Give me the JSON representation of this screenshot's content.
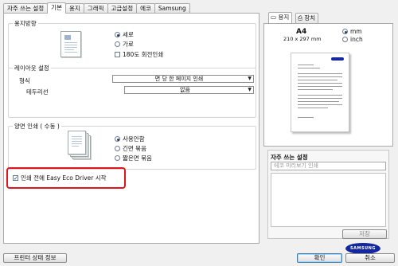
{
  "tabs": [
    "자주 쓰는 설정",
    "기본",
    "용지",
    "그래픽",
    "고급설정",
    "에코",
    "Samsung"
  ],
  "active_tab_index": 1,
  "orientation": {
    "title": "용지방향",
    "portrait": "세로",
    "landscape": "가로",
    "rotate_180": "180도 회전인쇄"
  },
  "layout": {
    "title": "레이아웃 설정",
    "type_label": "형식",
    "type_value": "면 당 한 페이지 인쇄",
    "border_label": "테두리선",
    "border_value": "없음"
  },
  "duplex": {
    "title": "양면 인쇄 ( 수동 )",
    "none": "사용안함",
    "long_edge": "긴면 묶음",
    "short_edge": "짧은면 묶음"
  },
  "eco": {
    "label": "인쇄 전에 Easy Eco Driver 시작",
    "checked": true
  },
  "right_panel": {
    "tab_paper": "용지",
    "tab_device": "장치",
    "paper_size": "A4",
    "paper_dims": "210 x 297 mm",
    "unit_mm": "mm",
    "unit_inch": "inch",
    "favorites_title": "자주 쓰는 설정",
    "favorites_placeholder": "에코 미리보기 인쇄",
    "save_button": "저장"
  },
  "bottom": {
    "printer_status": "프린터 상태 정보",
    "ok": "확인",
    "cancel": "취소"
  },
  "logo_text": "SAMSUNG",
  "colors": {
    "highlight": "#e1141b",
    "brand_blue": "#1428a0"
  }
}
